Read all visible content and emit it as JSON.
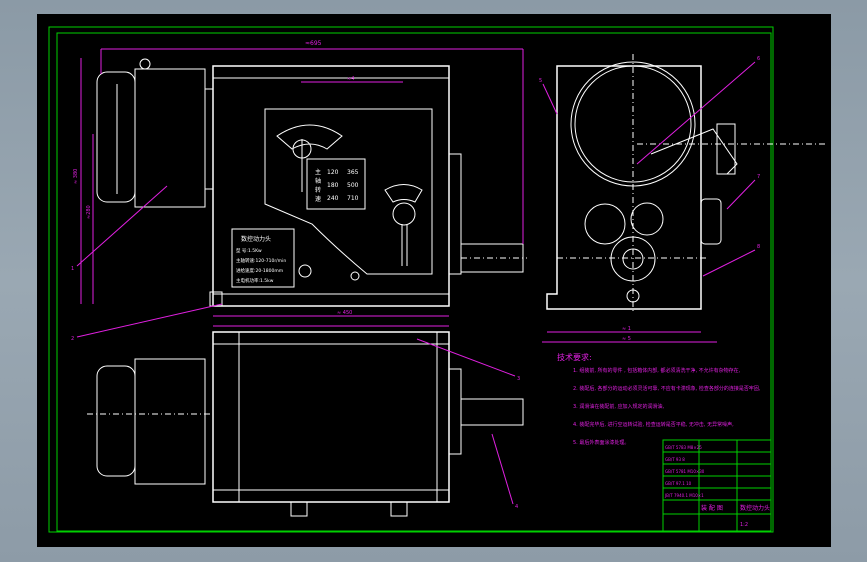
{
  "drawing": {
    "dimensions": {
      "top_overall": "≈695",
      "top_inner": "≈4",
      "left_height": "≈ 380",
      "left_height2": "≈280",
      "bottom_base": "≈ 450",
      "side_width1": "≈ 1",
      "side_width2": "≈ 5"
    },
    "speed_plate": {
      "label_col": [
        "主",
        "轴",
        "转",
        "速"
      ],
      "row1": [
        "120",
        "365"
      ],
      "row2": [
        "180",
        "500"
      ],
      "row3": [
        "240",
        "710"
      ]
    },
    "name_plate": {
      "title": "数控动力头",
      "lines": [
        "型 号:1.5Kw",
        "主轴转速:120-710r/min",
        "进给速度:20-1800mm",
        "主电机功率:1.5kw"
      ]
    },
    "tech_requirements": {
      "title": "技术要求:",
      "items": [
        "1. 组装前, 所有的零件 , 包括箱体内部, 都必须清洗干净, 不允许有杂物存在,",
        "2. 装配后, 各部分的运动必须灵活可靠, 不应有卡滞现象, 检查各部分的连接是否牢固,",
        "3. 润滑油在装配前, 应加入规定的润滑油,",
        "4. 装配完毕后, 进行空运转试验, 检查运转是否平稳, 无冲击, 无异常噪声,",
        "5. 最后外表面涂漆处理。"
      ]
    },
    "title_block": {
      "name": "数控动力头",
      "drawing_type": "装 配 图",
      "scale": "1:2",
      "rows": [
        "GB/T 5783 M8×25",
        "GB/T 93 8",
        "GB/T 5781 M10×30",
        "GB/T 97.1 10",
        "JB/T 7940.1 M10×1"
      ]
    },
    "leaders": [
      "1",
      "2",
      "3",
      "4",
      "5",
      "6",
      "7",
      "8"
    ]
  },
  "colors": {
    "background": "#000000",
    "frame": "#00d000",
    "lines": "#ffffff",
    "annotation": "#e020e0"
  }
}
